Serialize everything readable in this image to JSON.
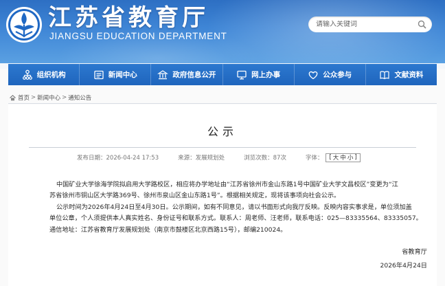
{
  "header": {
    "site_title_cn": "江苏省教育厅",
    "site_title_en": "JIANGSU EDUCATION DEPARTMENT",
    "search_placeholder": "请输入关键词"
  },
  "nav": {
    "items": [
      {
        "label": "组织机构",
        "icon": "org-chart-icon"
      },
      {
        "label": "新闻中心",
        "icon": "news-icon"
      },
      {
        "label": "政府信息公开",
        "icon": "government-building-icon"
      },
      {
        "label": "网上办事",
        "icon": "monitor-icon"
      },
      {
        "label": "公众参与",
        "icon": "heart-icon"
      },
      {
        "label": "文献资料",
        "icon": "book-icon"
      }
    ]
  },
  "breadcrumb": {
    "items": [
      "首页",
      "新闻中心",
      "通知公告"
    ],
    "separator": ">"
  },
  "article": {
    "title": "公示",
    "meta": {
      "published": "发布日期：2026-04-24 17:53",
      "source": "来源：发展规划处",
      "views": "浏览次数：87次",
      "fontsize_label": "字体：",
      "fontsize_options": [
        "大",
        "中",
        "小"
      ],
      "fontsize_open": "[",
      "fontsize_close": "]"
    },
    "paragraphs": [
      "中国矿业大学徐海学院拟启用大学路校区，相应将办学地址由“江苏省徐州市金山东路1号中国矿业大学文昌校区”变更为“江",
      "苏省徐州市铜山区大学路369号、徐州市泉山区金山东路1号”。根据相关规定，现将该事项向社会公示。",
      "公示时间为2026年4月24日至4月30日。公示期间，如有不同意见，请以书面形式向我厅反映。反映内容实事求是，单位须加盖",
      "单位公章，个人须提供本人真实姓名、身份证号和联系方式。联系人：周老师、汪老师，联系电话：025—83335564、83335057。",
      "通信地址：江苏省教育厅发展规划处（南京市鼓楼区北京西路15号），邮编210024。"
    ],
    "signature": "省教育厅",
    "date": "2026年4月24日"
  },
  "colors": {
    "header_blue": "#3f86d6",
    "nav_blue": "#1f65bd",
    "text": "#2a2a2a"
  }
}
